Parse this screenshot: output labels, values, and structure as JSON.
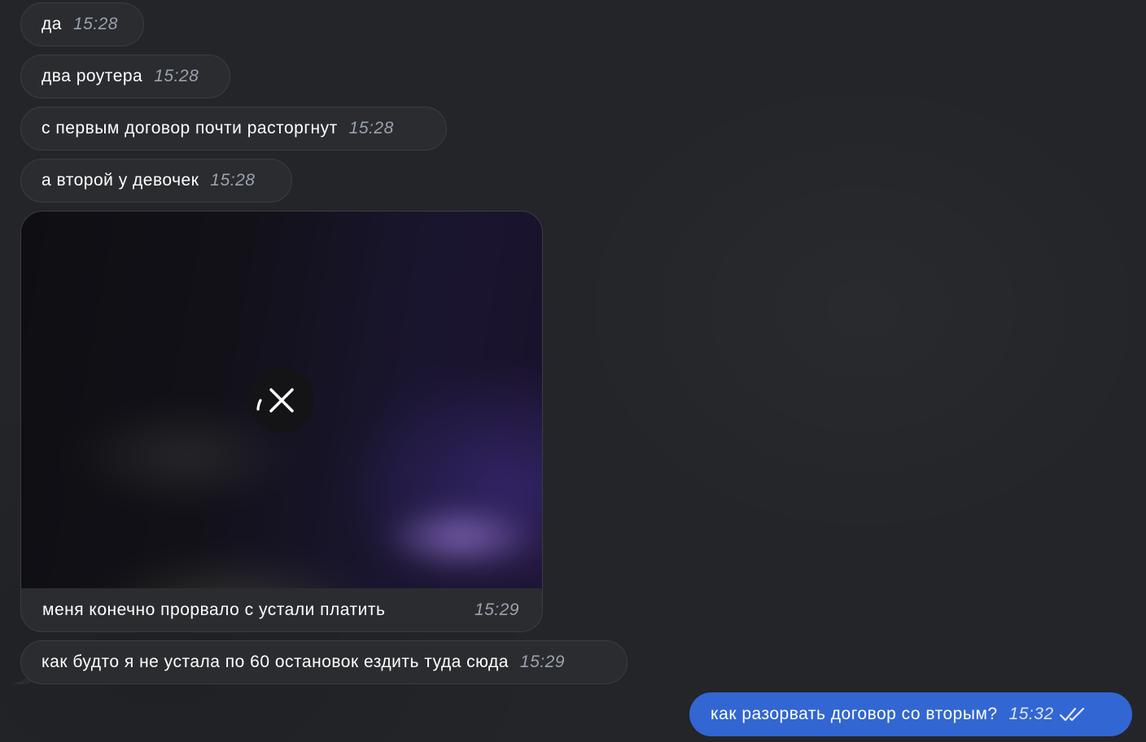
{
  "chat": {
    "incoming": [
      {
        "text": "да",
        "time": "15:28"
      },
      {
        "text": "два роутера",
        "time": "15:28"
      },
      {
        "text": "с первым договор почти расторгнут",
        "time": "15:28"
      },
      {
        "text": "а второй у девочек",
        "time": "15:28"
      }
    ],
    "media_message": {
      "caption": "меня конечно прорвало с устали платить",
      "time": "15:29",
      "cancel_icon": "close-icon",
      "blurred": true
    },
    "last_incoming": {
      "text": "как будто я не устала по 60 остановок ездить туда сюда",
      "time": "15:29"
    },
    "outgoing": {
      "text": "как разорвать договор со вторым?",
      "time": "15:32",
      "status_icon": "double-check-icon"
    }
  },
  "colors": {
    "background": "#232529",
    "incoming_bubble": "#2a2c30",
    "outgoing_bubble": "#3266d2",
    "timestamp": "#9aa2ad"
  }
}
